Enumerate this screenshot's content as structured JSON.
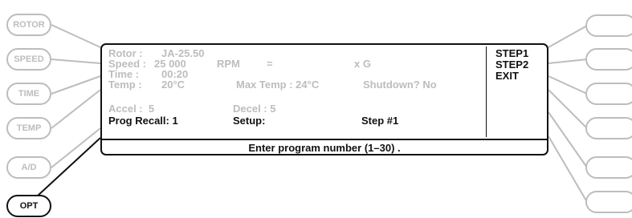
{
  "left_buttons": [
    {
      "label": "ROTOR",
      "active": false
    },
    {
      "label": "SPEED",
      "active": false
    },
    {
      "label": "TIME",
      "active": false
    },
    {
      "label": "TEMP",
      "active": false
    },
    {
      "label": "A/D",
      "active": false
    },
    {
      "label": "OPT",
      "active": true
    }
  ],
  "right_buttons_count": 6,
  "display": {
    "rotor_label": "Rotor :",
    "rotor_value": "JA-25.50",
    "speed_label": "Speed :",
    "speed_value": "25 000",
    "speed_unit": "RPM",
    "equals": "=",
    "xg": "x G",
    "time_label": "Time :",
    "time_value": "00:20",
    "temp_label": "Temp :",
    "temp_value": "20°C",
    "max_temp": "Max Temp : 24°C",
    "shutdown": "Shutdown? No",
    "accel": "Accel :  5",
    "decel": "Decel : 5",
    "prog_recall": "Prog Recall: 1",
    "setup": "Setup:",
    "step": "Step #1",
    "prompt": "Enter program number (1–30) ."
  },
  "options": [
    "STEP1",
    "STEP2",
    "EXIT"
  ],
  "colors": {
    "active": "#111111",
    "inactive": "#bdbdbd"
  }
}
